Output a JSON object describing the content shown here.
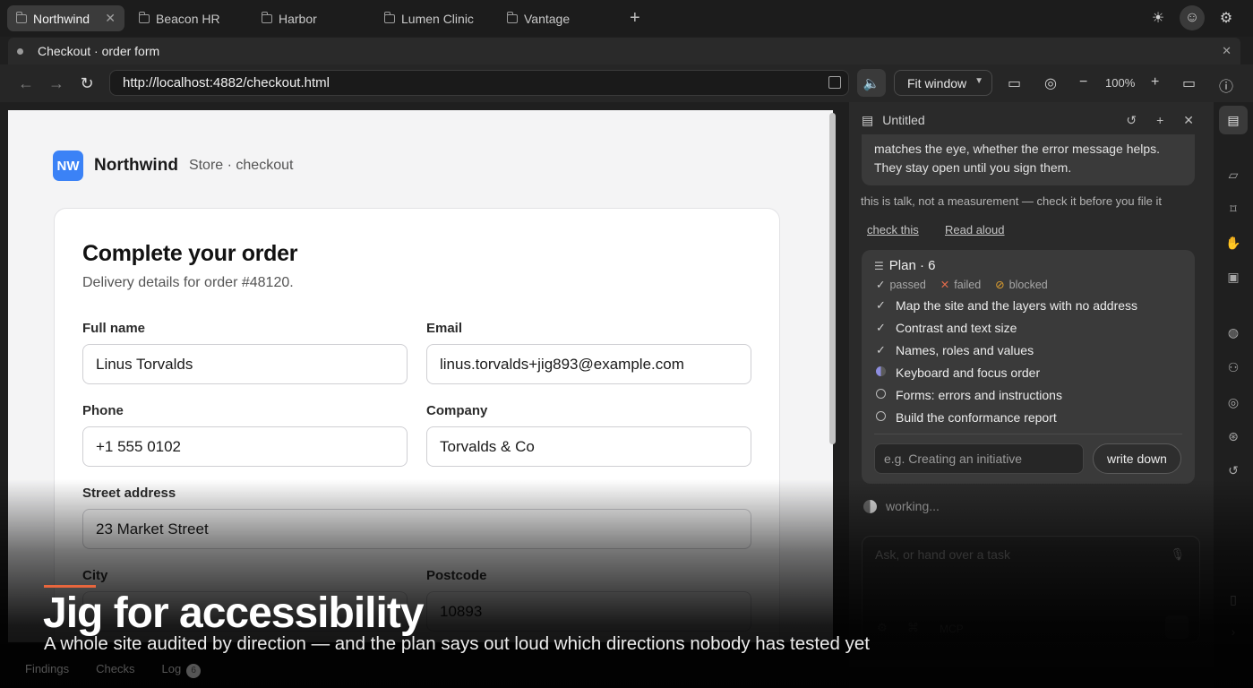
{
  "tabs": [
    {
      "label": "Northwind",
      "active": true
    },
    {
      "label": "Beacon HR",
      "active": false
    },
    {
      "label": "Harbor",
      "active": false
    },
    {
      "label": "Lumen Clinic",
      "active": false
    },
    {
      "label": "Vantage",
      "active": false
    }
  ],
  "document_title": "Checkout · order form",
  "url": "http://localhost:4882/checkout.html",
  "fit_label": "Fit window",
  "zoom_level": "100%",
  "brand": {
    "initials": "NW",
    "name": "Northwind",
    "subtitle": "Store · checkout"
  },
  "form": {
    "title": "Complete your order",
    "subtitle": "Delivery details for order #48120.",
    "fields": {
      "full_name": {
        "label": "Full name",
        "value": "Linus Torvalds"
      },
      "email": {
        "label": "Email",
        "value": "linus.torvalds+jig893@example.com"
      },
      "phone": {
        "label": "Phone",
        "value": "+1 555 0102"
      },
      "company": {
        "label": "Company",
        "value": "Torvalds & Co"
      },
      "street": {
        "label": "Street address",
        "value": "23 Market Street"
      },
      "city": {
        "label": "City",
        "value": ""
      },
      "postcode": {
        "label": "Postcode",
        "value": "10893"
      }
    }
  },
  "bottom_tabs": {
    "findings": "Findings",
    "checks": "Checks",
    "log": "Log",
    "log_count": "6"
  },
  "panel": {
    "title": "Untitled",
    "message": "matches the eye, whether the error message helps. They stay open until you sign them.",
    "note": "this is talk, not a measurement — check it before you file it",
    "link_check": "check this",
    "link_read": "Read aloud",
    "plan": {
      "title": "Plan · 6",
      "legend": {
        "passed": "passed",
        "failed": "failed",
        "blocked": "blocked"
      },
      "items": [
        {
          "label": "Map the site and the layers with no address",
          "status": "passed"
        },
        {
          "label": "Contrast and text size",
          "status": "passed"
        },
        {
          "label": "Names, roles and values",
          "status": "passed"
        },
        {
          "label": "Keyboard and focus order",
          "status": "in-progress"
        },
        {
          "label": "Forms: errors and instructions",
          "status": "pending"
        },
        {
          "label": "Build the conformance report",
          "status": "pending"
        }
      ],
      "input_placeholder": "e.g. Creating an initiative",
      "button": "write down"
    },
    "working": "working...",
    "ask_placeholder": "Ask, or hand over a task",
    "mcp": "MCP"
  },
  "overlay": {
    "headline": "Jig for accessibility",
    "tagline": "A whole site audited by direction — and the plan says out loud which directions nobody has tested yet"
  },
  "colors": {
    "accent": "#e8663d",
    "brand": "#3b82f6",
    "failed": "#e06a4a",
    "blocked": "#e0a030"
  }
}
